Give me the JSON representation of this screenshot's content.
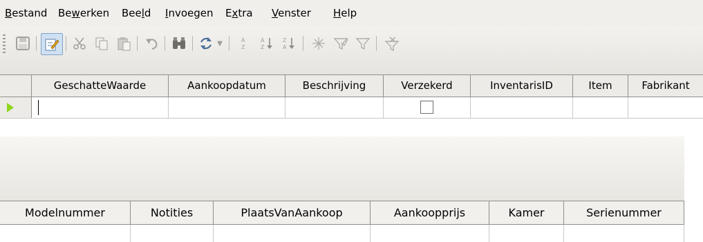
{
  "menu": [
    {
      "pre": "",
      "u": "B",
      "post": "estand"
    },
    {
      "pre": "Be",
      "u": "w",
      "post": "erken"
    },
    {
      "pre": "Bee",
      "u": "l",
      "post": "d"
    },
    {
      "pre": "",
      "u": "I",
      "post": "nvoegen"
    },
    {
      "pre": "E",
      "u": "x",
      "post": "tra"
    },
    {
      "pre": "",
      "u": "V",
      "post": "enster"
    },
    {
      "pre": "",
      "u": "H",
      "post": "elp"
    }
  ],
  "toolbar": {
    "icons": [
      "save-icon",
      "edit-mode-icon",
      "cut-icon",
      "copy-icon",
      "paste-icon",
      "undo-icon",
      "find-icon",
      "refresh-icon",
      "sort-icon",
      "sort-ascending-icon",
      "sort-descending-icon",
      "autofilter-icon",
      "standard-filter-icon",
      "apply-filter-icon",
      "remove-filter-icon"
    ]
  },
  "table1": {
    "columns": [
      "GeschatteWaarde",
      "Aankoopdatum",
      "Beschrijving",
      "Verzekerd",
      "InventarisID",
      "Item",
      "Fabrikant"
    ],
    "rows": [
      {
        "GeschatteWaarde": "",
        "Aankoopdatum": "",
        "Beschrijving": "",
        "Verzekerd": false,
        "InventarisID": "",
        "Item": "",
        "Fabrikant": ""
      }
    ]
  },
  "table2": {
    "columns": [
      "Modelnummer",
      "Notities",
      "PlaatsVanAankoop",
      "Aankoopprijs",
      "Kamer",
      "Serienummer"
    ]
  }
}
